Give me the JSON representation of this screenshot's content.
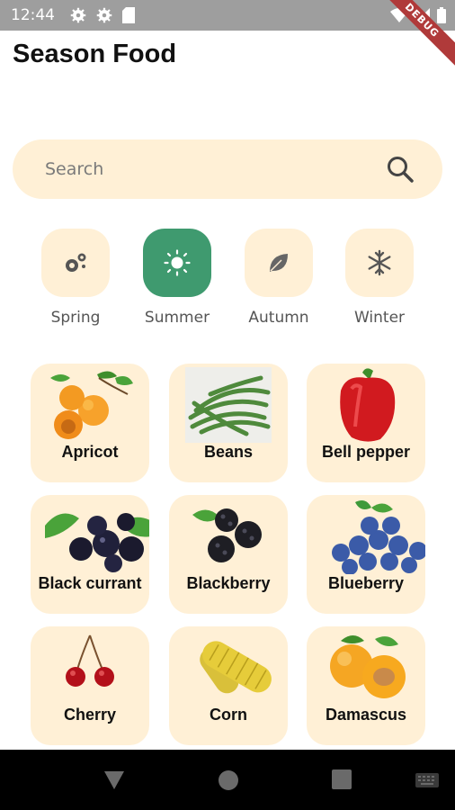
{
  "status": {
    "time": "12:44",
    "debug": "DEBUG"
  },
  "app": {
    "title": "Season Food"
  },
  "search": {
    "placeholder": "Search"
  },
  "seasons": [
    {
      "label": "Spring",
      "icon": "flower-icon",
      "selected": false
    },
    {
      "label": "Summer",
      "icon": "sun-icon",
      "selected": true
    },
    {
      "label": "Autumn",
      "icon": "leaf-icon",
      "selected": false
    },
    {
      "label": "Winter",
      "icon": "snowflake-icon",
      "selected": false
    }
  ],
  "foods": [
    {
      "label": "Apricot",
      "icon": "apricot-image"
    },
    {
      "label": "Beans",
      "icon": "beans-image"
    },
    {
      "label": "Bell pepper",
      "icon": "bell-pepper-image"
    },
    {
      "label": "Black currant",
      "icon": "black-currant-image"
    },
    {
      "label": "Blackberry",
      "icon": "blackberry-image"
    },
    {
      "label": "Blueberry",
      "icon": "blueberry-image"
    },
    {
      "label": "Cherry",
      "icon": "cherry-image"
    },
    {
      "label": "Corn",
      "icon": "corn-image"
    },
    {
      "label": "Damascus",
      "icon": "damascus-image"
    }
  ],
  "colors": {
    "accent": "#3f9a6f",
    "tile": "#fff0d6",
    "status_bar": "#9e9e9e"
  }
}
